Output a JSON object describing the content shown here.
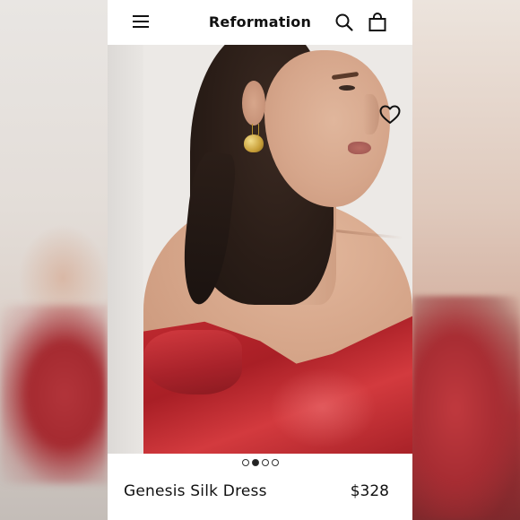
{
  "header": {
    "brand": "Reformation",
    "menu_icon": "hamburger-menu-icon",
    "search_icon": "search-icon",
    "bag_icon": "shopping-bag-icon"
  },
  "product": {
    "title": "Genesis Silk Dress",
    "price": "$328",
    "favorite_icon": "heart-icon",
    "image_count": 4,
    "active_image_index": 1
  },
  "colors": {
    "dress": "#b0242b",
    "text": "#111111",
    "background": "#ffffff"
  }
}
